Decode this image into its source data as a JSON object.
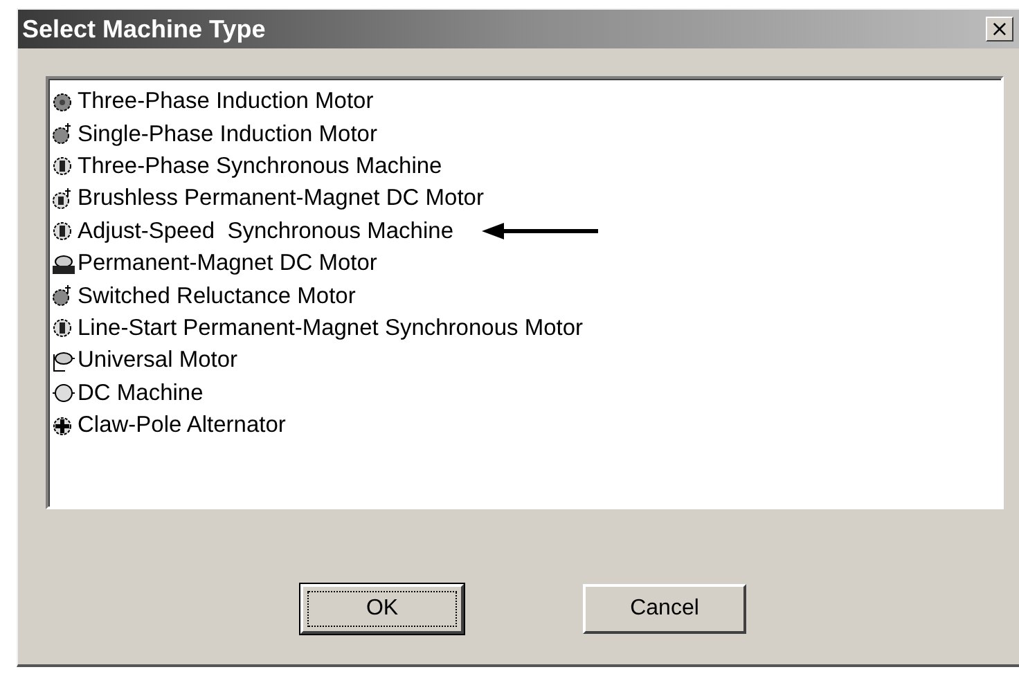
{
  "window": {
    "title": "Select Machine Type",
    "close": "×"
  },
  "machines": [
    {
      "label": "Three-Phase Induction Motor",
      "kind": "filled"
    },
    {
      "label": "Single-Phase Induction Motor",
      "kind": "filled-star"
    },
    {
      "label": "Three-Phase Synchronous Machine",
      "kind": "rotor"
    },
    {
      "label": "Brushless Permanent-Magnet DC Motor",
      "kind": "rotor-star"
    },
    {
      "label": "Adjust-Speed  Synchronous Machine",
      "kind": "rotor",
      "pointed": true
    },
    {
      "label": "Permanent-Magnet DC Motor",
      "kind": "dc"
    },
    {
      "label": "Switched Reluctance Motor",
      "kind": "filled-star"
    },
    {
      "label": "Line-Start Permanent-Magnet Synchronous Motor",
      "kind": "rotor"
    },
    {
      "label": "Universal Motor",
      "kind": "universal"
    },
    {
      "label": "DC Machine",
      "kind": "plain"
    },
    {
      "label": "Claw-Pole Alternator",
      "kind": "cross"
    }
  ],
  "buttons": [
    {
      "label": "OK",
      "default": true
    },
    {
      "label": "Cancel",
      "default": false
    }
  ]
}
